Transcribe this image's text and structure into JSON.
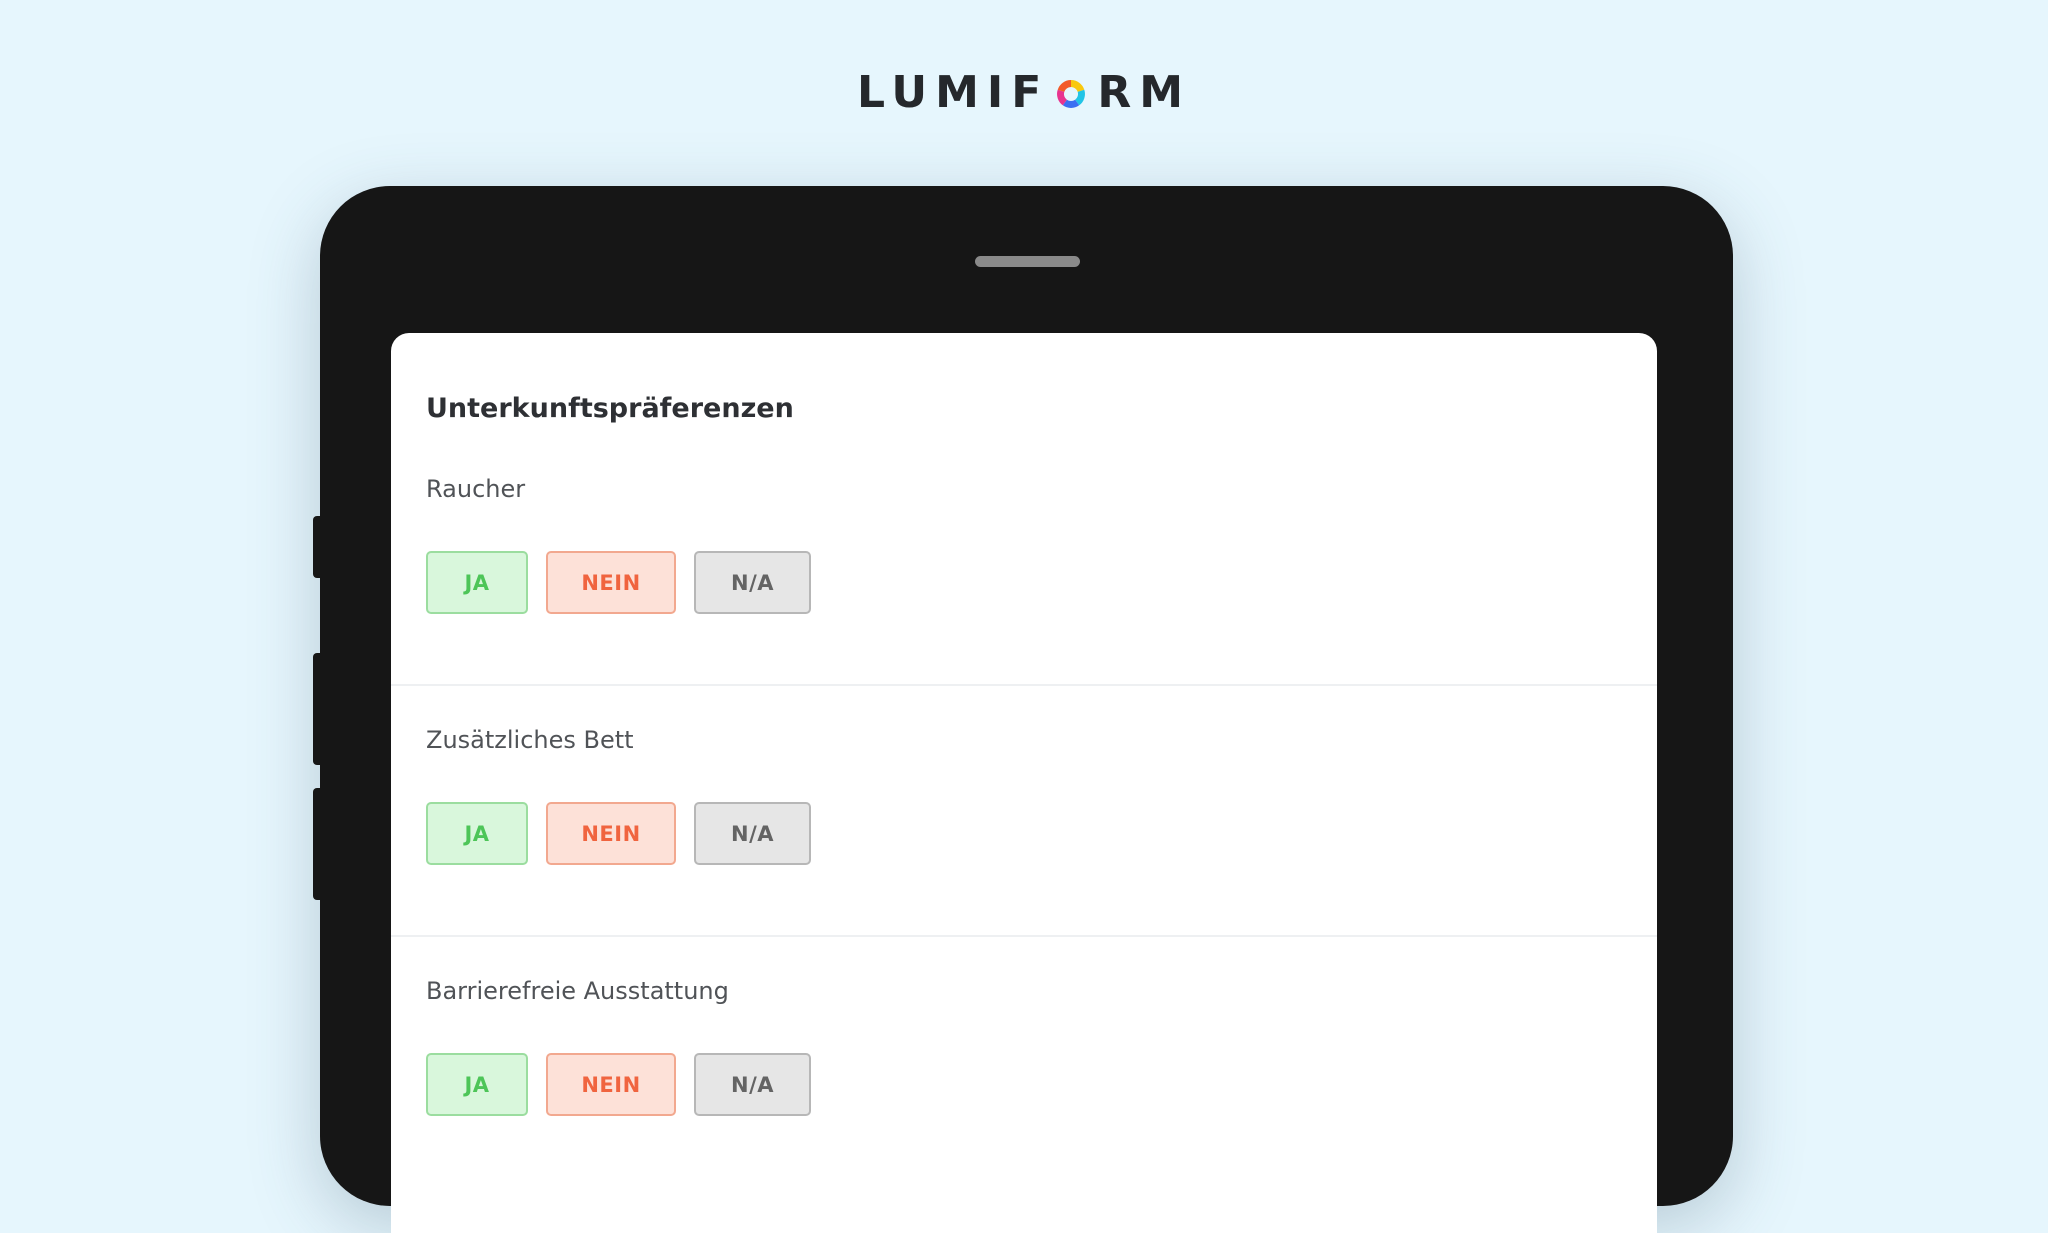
{
  "brand": {
    "logo_left": "LUMIF",
    "logo_right": "RM",
    "logo_mark_colors": [
      "#f9c80e",
      "#21c4e6",
      "#3b6ff2",
      "#e8338f",
      "#f25a2a"
    ]
  },
  "form": {
    "title": "Unterkunftspräferenzen",
    "questions": [
      {
        "label": "Raucher",
        "options": {
          "yes": "JA",
          "no": "NEIN",
          "na": "N/A"
        }
      },
      {
        "label": "Zusätzliches Bett",
        "options": {
          "yes": "JA",
          "no": "NEIN",
          "na": "N/A"
        }
      },
      {
        "label": "Barrierefreie Ausstattung",
        "options": {
          "yes": "JA",
          "no": "NEIN",
          "na": "N/A"
        }
      }
    ]
  },
  "colors": {
    "background": "#e6f6fd",
    "device": "#161616",
    "yes_text": "#4dc558",
    "no_text": "#f0643f",
    "na_text": "#646464"
  }
}
